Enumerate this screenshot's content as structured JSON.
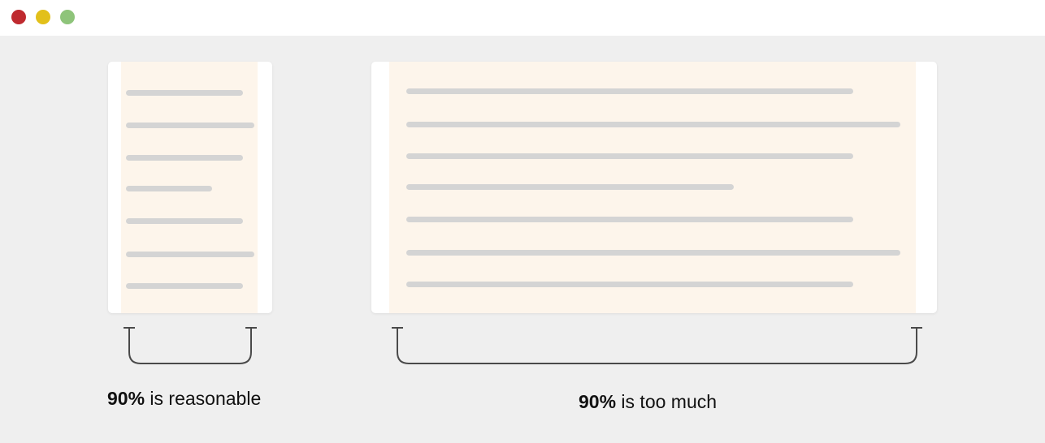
{
  "window": {
    "controls": [
      "close",
      "minimize",
      "maximize"
    ],
    "colors": {
      "close": "#bf2a2f",
      "minimize": "#e2c01a",
      "maximize": "#8ec47a"
    }
  },
  "colors": {
    "background": "#efefef",
    "card": "#ffffff",
    "content_area": "#fdf5eb",
    "text_line": "#d4d4d4",
    "bracket": "#4a4a4a"
  },
  "examples": [
    {
      "id": "narrow",
      "caption_bold": "90%",
      "caption_rest": " is reasonable"
    },
    {
      "id": "wide",
      "caption_bold": "90%",
      "caption_rest": " is too much"
    }
  ]
}
